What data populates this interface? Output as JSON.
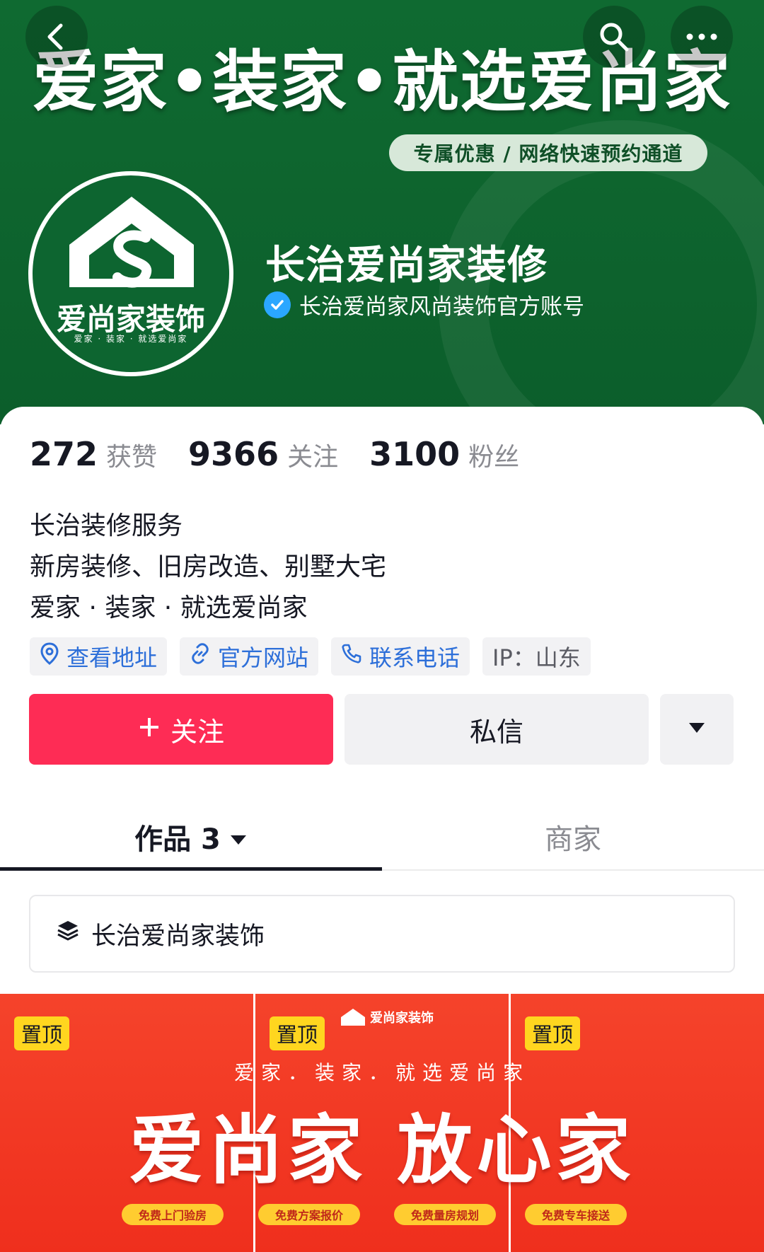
{
  "banner": {
    "slogan": "爱家•装家•就选爱尚家",
    "promo": "专属优惠 / 网络快速预约通道"
  },
  "avatar": {
    "brand_name": "爱尚家装饰",
    "brand_sub": "爱家 · 装家 · 就选爱尚家"
  },
  "profile": {
    "name": "长治爱尚家装修",
    "verified_text": "长治爱尚家风尚装饰官方账号"
  },
  "stats": [
    {
      "num": "272",
      "label": "获赞"
    },
    {
      "num": "9366",
      "label": "关注"
    },
    {
      "num": "3100",
      "label": "粉丝"
    }
  ],
  "bio": [
    "长治装修服务",
    "新房装修、旧房改造、别墅大宅",
    "爱家 · 装家 · 就选爱尚家"
  ],
  "tags": {
    "address": "查看地址",
    "website": "官方网站",
    "phone": "联系电话",
    "ip": "IP：山东"
  },
  "actions": {
    "follow": "关注",
    "message": "私信"
  },
  "tabs": {
    "works": "作品 3",
    "shop": "商家"
  },
  "collection": {
    "name": "长治爱尚家装饰"
  },
  "videos": {
    "pin_label": "置顶",
    "tile_logo": "爱尚家装饰",
    "slogan": "爱家．装家．就选爱尚家",
    "headline": "爱尚家  放心家",
    "pills": [
      "免费上门验房",
      "免费方案报价",
      "免费量房规划",
      "免费专车接送"
    ]
  },
  "colors": {
    "banner_green": "#0f6a31",
    "follow_red": "#fe2c55",
    "link_blue": "#2d6fd9",
    "verify_blue": "#2aa7ff",
    "tile_red": "#f5432b",
    "pin_yellow": "#ffd61f"
  },
  "icons": [
    "back-icon",
    "search-icon",
    "more-icon",
    "verified-icon",
    "location-icon",
    "link-icon",
    "phone-icon",
    "plus-icon",
    "dropdown-icon",
    "layers-icon"
  ]
}
